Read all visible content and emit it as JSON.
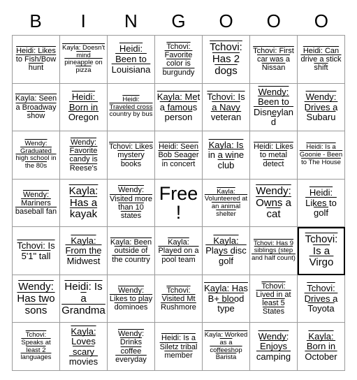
{
  "header": {
    "letters": [
      "B",
      "I",
      "N",
      "G",
      "O",
      "O",
      "O"
    ]
  },
  "grid": {
    "columns": 7,
    "rows": 7,
    "free_space_label": "Free!",
    "marked_cell": "Tchovi: Is a Virgo",
    "cells": [
      [
        "Heidi: Likes to Fish/Bow hunt",
        "Kayla: Doesn't mind pineapple on pizza",
        "Heidi: Been to Louisiana",
        "Tchovi: Favorite color is burgundy",
        "Tchovi: Has 2 dogs",
        "Tchovi: First car was a Nissan",
        "Heidi: Can drive a stick shift"
      ],
      [
        "Kayla: Seen a Broadway show",
        "Heidi: Born in Oregon",
        "Heidi: Traveled cross country by bus",
        "Kayla: Met a famous person",
        "Tchovi: Is a Navy veteran",
        "Wendy: Been to Disneyland",
        "Wendy: Drives a Subaru"
      ],
      [
        "Wendy: Graduated high school in the 80s",
        "Wendy: Favorite candy is Reese's",
        "Tchovi: Likes mystery books",
        "Heidi: Seen Bob Seager in concert",
        "Kayla: Is in a wine club",
        "Heidi: Likes to metal detect",
        "Heidi: Is a Goonie - Been to The House"
      ],
      [
        "Wendy: Mariners baseball fan",
        "Kayla: Has a kayak",
        "Wendy: Visited more than 10 states",
        "Free!",
        "Kayla: Volunteered at an animal shelter",
        "Wendy: Owns a cat",
        "Heidi: Likes to golf"
      ],
      [
        "Tchovi: Is 5'1\" tall",
        "Kayla: From the Midwest",
        "Kayla: Been outside of the country",
        "Kayla: Played on a pool team",
        "Kayla: Plays disc golf",
        "Tchovi: Has 9 siblings (step and half count)",
        "Tchovi: Is a Virgo"
      ],
      [
        "Wendy: Has two sons",
        "Heidi: Is a Grandma",
        "Wendy: Likes to play dominoes",
        "Tchovi: Visited Mt Rushmore",
        "Kayla: Has B+ blood type",
        "Tchovi: Lived in at least 5 States",
        "Tchovi: Drives a Toyota"
      ],
      [
        "Tchovi: Speaks at least 2 languages",
        "Kayla: Loves scary movies",
        "Wendy: Drinks coffee everyday",
        "Heidi: Is a Siletz tribal member",
        "Kayla: Worked as a coffeeshop Barista",
        "Wendy: Enjoys camping",
        "Kayla: Born in October"
      ]
    ]
  },
  "colors": {
    "background": "#ffffff",
    "text": "#000000",
    "grid_line": "#9a9a9a",
    "marked_border": "#000000"
  }
}
